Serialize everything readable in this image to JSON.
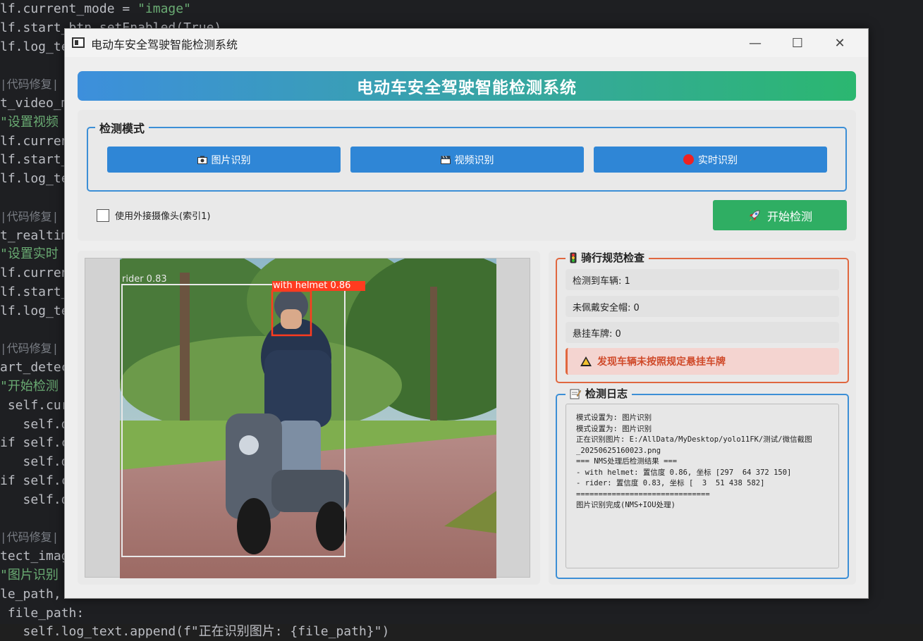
{
  "editor": {
    "lines": [
      {
        "t": "lf.current_mode = ",
        "s": "\"image\""
      },
      {
        "t": "lf.start_btn.setEnabled(True)",
        "s": ""
      },
      {
        "t": "lf.log_te",
        "s": ""
      },
      {
        "t": "",
        "s": ""
      },
      {
        "t": "",
        "c": "|代码修复|"
      },
      {
        "t": "t_video_m",
        "s": ""
      },
      {
        "t": "",
        "s": "\"设置视频"
      },
      {
        "t": "lf.curren",
        "s": ""
      },
      {
        "t": "lf.start_",
        "s": ""
      },
      {
        "t": "lf.log_te",
        "s": ""
      },
      {
        "t": "",
        "s": ""
      },
      {
        "t": "",
        "c": "|代码修复|"
      },
      {
        "t": "t_realtim",
        "s": ""
      },
      {
        "t": "",
        "s": "\"设置实时"
      },
      {
        "t": "lf.curren",
        "s": ""
      },
      {
        "t": "lf.start_",
        "s": ""
      },
      {
        "t": "lf.log_te",
        "s": ""
      },
      {
        "t": "",
        "s": ""
      },
      {
        "t": "",
        "c": "|代码修复|"
      },
      {
        "t": "art_detec",
        "s": ""
      },
      {
        "t": "",
        "s": "\"开始检测"
      },
      {
        "t": " self.cur",
        "s": ""
      },
      {
        "t": "   self.de",
        "s": ""
      },
      {
        "t": "if self.c",
        "s": ""
      },
      {
        "t": "   self.de",
        "s": ""
      },
      {
        "t": "if self.c",
        "s": ""
      },
      {
        "t": "   self.de",
        "s": ""
      },
      {
        "t": "",
        "s": ""
      },
      {
        "t": "",
        "c": "|代码修复|"
      },
      {
        "t": "tect_imag",
        "s": ""
      },
      {
        "t": "",
        "s": "\"图片识别"
      },
      {
        "t": "le_path,",
        "s": ""
      },
      {
        "t": " file_path:",
        "s": ""
      },
      {
        "t": "   self.log_text.append(f\"正在识别图片: {file_path}\")",
        "s": ""
      }
    ]
  },
  "window": {
    "title": "电动车安全驾驶智能检测系统",
    "minimize": "—",
    "maximize": "☐",
    "close": "✕"
  },
  "banner": {
    "title": "电动车安全驾驶智能检测系统"
  },
  "mode": {
    "group_title": "检测模式",
    "image_btn": "图片识别",
    "video_btn": "视频识别",
    "realtime_btn": "实时识别",
    "camera_label": "使用外接摄像头(索引1)",
    "camera_checked": false,
    "start_btn": "开始检测"
  },
  "detections": [
    {
      "label": "rider 0.83",
      "color": "#e8e8e8"
    },
    {
      "label": "with helmet 0.86",
      "color": "#ff3b1f"
    }
  ],
  "rules": {
    "title": "骑行规范检查",
    "vehicles": "检测到车辆: 1",
    "no_helmet": "未佩戴安全帽: 0",
    "plate": "悬挂车牌: 0",
    "warning": "发现车辆未按照规定悬挂车牌"
  },
  "log": {
    "title": "检测日志",
    "lines": [
      "模式设置为: 图片识别",
      "模式设置为: 图片识别",
      "正在识别图片: E:/AllData/MyDesktop/yolo11FK/测试/微信截图",
      "_20250625160023.png",
      "=== NMS处理后检测结果 ===",
      "- with helmet: 置信度 0.86, 坐标 [297  64 372 150]",
      "- rider: 置信度 0.83, 坐标 [  3  51 438 582]",
      "==============================",
      "图片识别完成(NMS+IOU处理)"
    ]
  },
  "colors": {
    "accent_blue": "#2f86d6",
    "start_green": "#2fae63",
    "warning_orange": "#e0673f"
  }
}
